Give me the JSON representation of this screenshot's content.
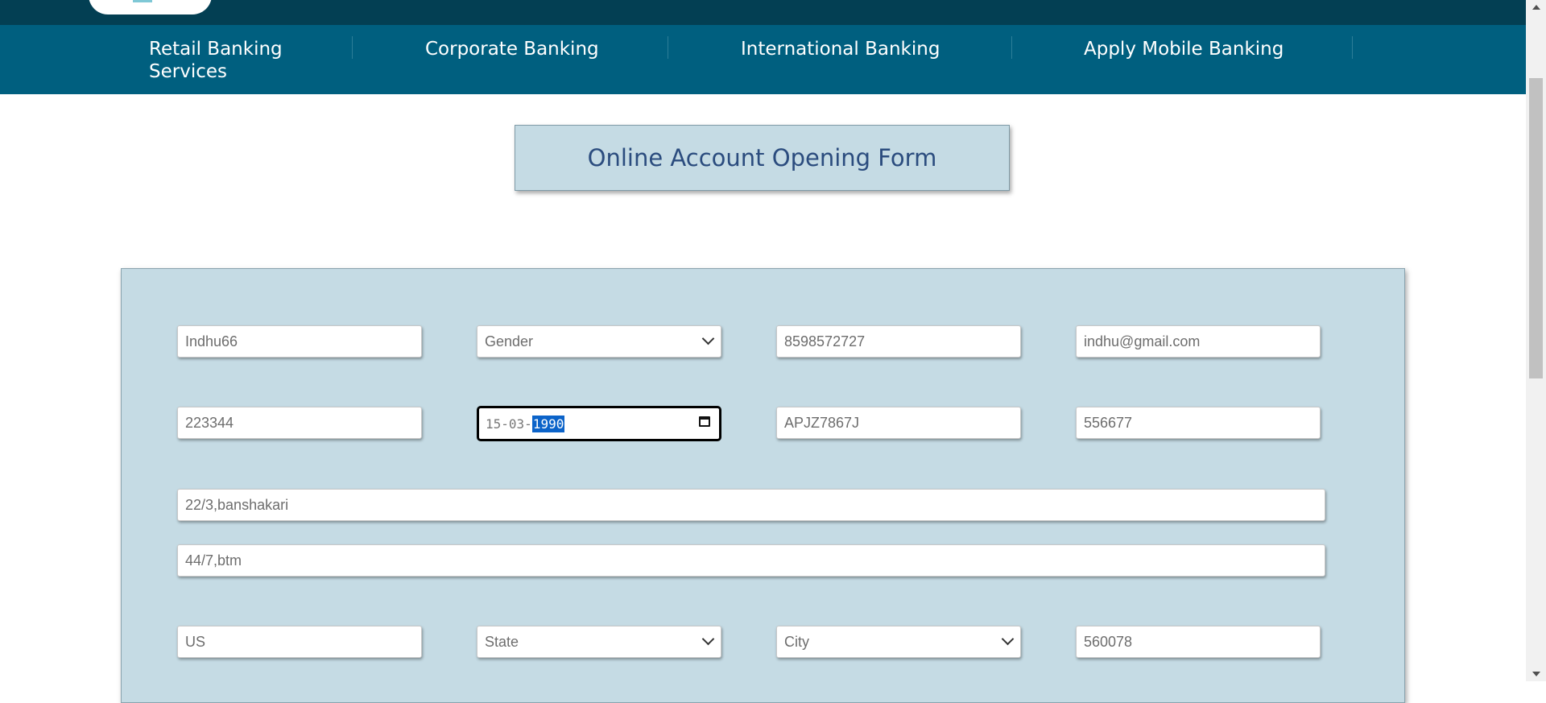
{
  "nav": {
    "items": [
      {
        "label": "Retail Banking"
      },
      {
        "label": "Services"
      },
      {
        "label": "Corporate Banking"
      },
      {
        "label": "International Banking"
      },
      {
        "label": "Apply Mobile Banking"
      }
    ]
  },
  "title": "Online Account Opening Form",
  "form": {
    "username": "Indhu66",
    "gender": "Gender",
    "phone": "8598572727",
    "email": "indhu@gmail.com",
    "field_223344": "223344",
    "dob_day": "15",
    "dob_sep1": "-",
    "dob_month": "03",
    "dob_sep2": "-",
    "dob_year": "1990",
    "pan": "APJZ7867J",
    "field_556677": "556677",
    "address1": "22/3,banshakari",
    "address2": "44/7,btm",
    "country": "US",
    "state": "State",
    "city": "City",
    "pincode": "560078"
  },
  "colors": {
    "topbar": "#033f53",
    "navbar": "#005f7f",
    "panel": "#c5dbe4",
    "title_text": "#2b4c7e",
    "selection": "#0b63c9"
  },
  "icons": [
    "calendar-icon",
    "chevron-down-icon",
    "scroll-up-icon",
    "scroll-down-icon"
  ]
}
